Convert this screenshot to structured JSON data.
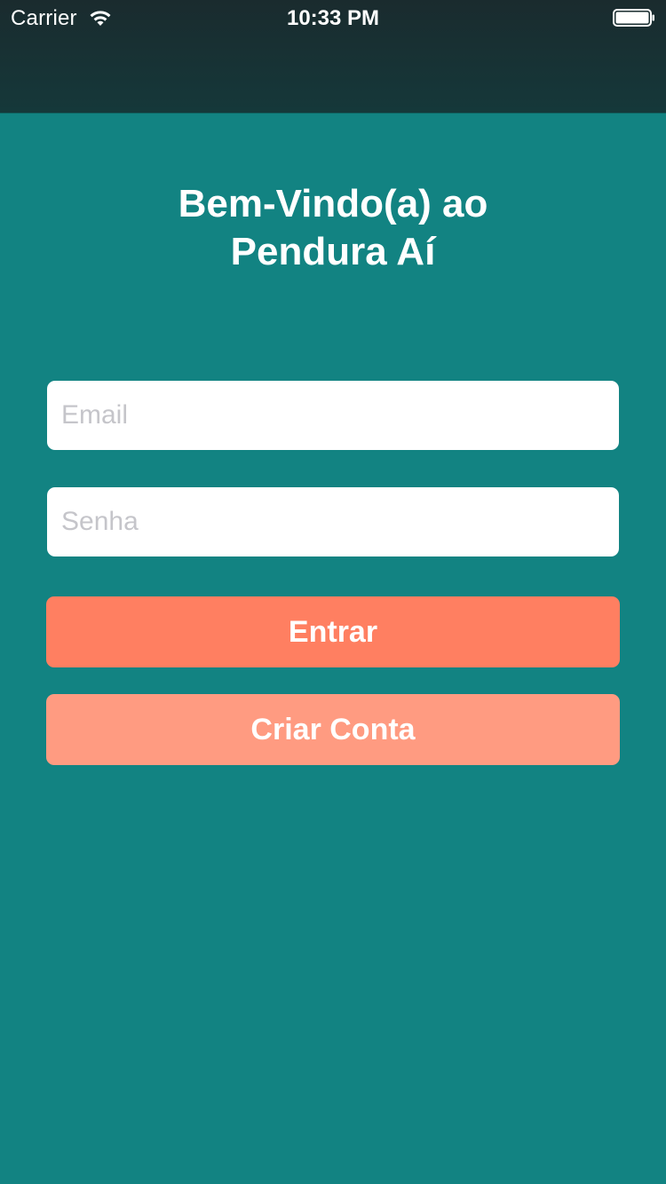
{
  "status_bar": {
    "carrier": "Carrier",
    "time": "10:33 PM",
    "wifi_icon": "wifi-icon",
    "battery_icon": "battery-icon"
  },
  "colors": {
    "background": "#128382",
    "navbar": "#15383a",
    "primary_button": "#ff7f61",
    "secondary_button": "#ff9b81",
    "text_on_color": "#ffffff",
    "placeholder": "#c5c5ca"
  },
  "main": {
    "title_line1": "Bem-Vindo(a) ao",
    "title_line2": "Pendura Aí",
    "email_placeholder": "Email",
    "email_value": "",
    "password_placeholder": "Senha",
    "password_value": "",
    "login_label": "Entrar",
    "signup_label": "Criar Conta"
  }
}
